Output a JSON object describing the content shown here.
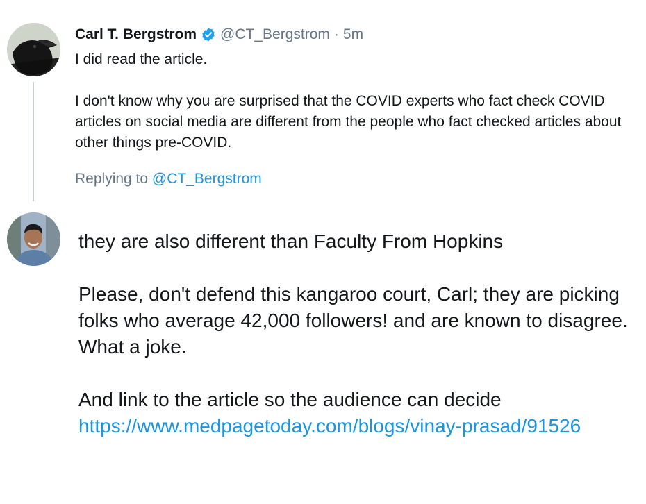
{
  "tweet": {
    "author_name": "Carl T. Bergstrom",
    "handle": "@CT_Bergstrom",
    "separator": "·",
    "timestamp": "5m",
    "verified_icon": "verified-badge-icon",
    "paragraphs": [
      "I did read the article.",
      "I don't know why you are surprised that the COVID experts  who fact check COVID articles on social media are different from the people who fact checked articles about other things pre-COVID."
    ],
    "replying_prefix": "Replying to",
    "replying_handle": "@CT_Bergstrom"
  },
  "reply": {
    "paragraphs": [
      "they are also different than Faculty From Hopkins",
      "Please, don't defend this kangaroo court, Carl; they are picking folks who average 42,000 followers! and are known to disagree.  What a joke."
    ],
    "closing_text": "And link to the article so the audience can decide",
    "link": "https://www.medpagetoday.com/blogs/vinay-prasad/91526"
  },
  "colors": {
    "text": "#14171a",
    "secondary": "#657786",
    "link": "#1b95e0",
    "verified": "#1da1f2",
    "thread_line": "#c4cfd6"
  }
}
